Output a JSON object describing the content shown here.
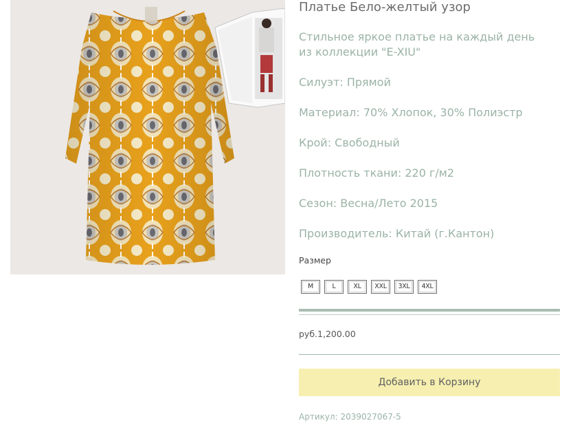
{
  "product": {
    "title": "Платье Бело-желтый узор",
    "description": "Стильное яркое платье на каждый день из коллекции \"E-XIU\"",
    "attributes": [
      "Силуэт: Прямой",
      "Материал: 70% Хлопок, 30% Полиэстр",
      "Крой: Свободный",
      "Плотность ткани: 220 г/м2",
      "Сезон: Весна/Лето 2015",
      "Производитель: Китай (г.Кантон)"
    ],
    "size_label": "Размер",
    "sizes": [
      "M",
      "L",
      "XL",
      "XXL",
      "3XL",
      "4XL"
    ],
    "price": "руб.1,200.00",
    "add_to_cart_label": "Добавить в Корзину",
    "sku": "Артикул: 2039027067-5"
  },
  "colors": {
    "title": "#6b6b6b",
    "text_accent": "#9bb3a6",
    "divider": "#a9bdb3",
    "button_bg": "#f6efb0",
    "dress_main": "#e9a51d"
  }
}
